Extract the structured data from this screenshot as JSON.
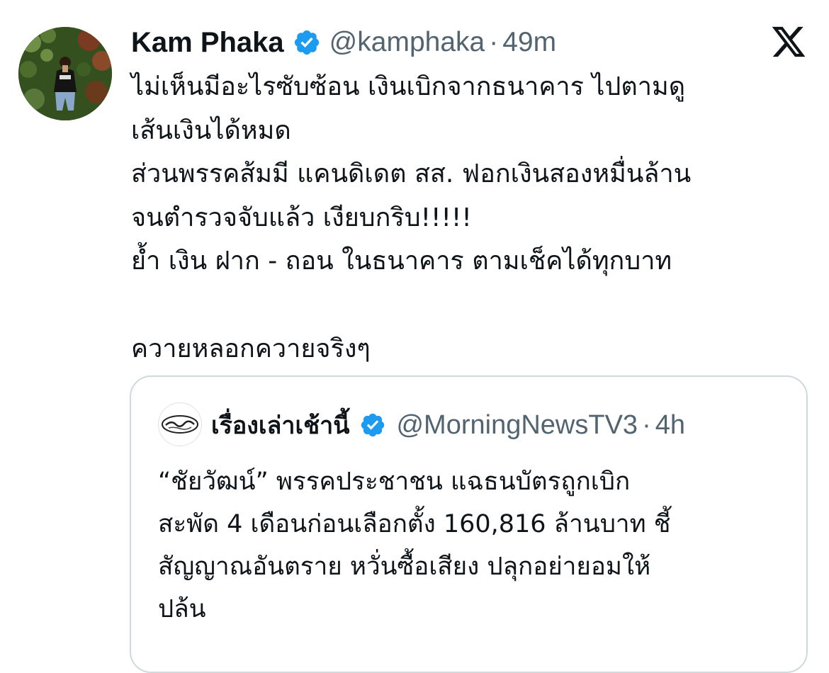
{
  "tweet": {
    "author": {
      "display_name": "Kam Phaka",
      "handle": "@kamphaka",
      "verified_icon": "verified-badge-icon",
      "avatar_icon": "profile-photo"
    },
    "separator": "·",
    "timestamp": "49m",
    "platform_logo": "x-logo-icon",
    "lines": [
      "ไม่เห็นมีอะไรซับซ้อน เงินเบิกจากธนาคาร ไปตามดู",
      "เส้นเงินได้หมด",
      "ส่วนพรรคส้มมี แคนดิเดต สส. ฟอกเงินสองหมื่นล้าน",
      "จนตำรวจจับแล้ว เงียบกริบ!!!!!",
      "ย้ำ เงิน ฝาก - ถอน ในธนาคาร ตามเช็คได้ทุกบาท",
      "",
      "ควายหลอกควายจริงๆ"
    ]
  },
  "quoted_tweet": {
    "author": {
      "display_name": "เรื่องเล่าเช้านี้",
      "handle": "@MorningNewsTV3",
      "verified_icon": "verified-badge-icon",
      "avatar_icon": "morning-news-logo"
    },
    "separator": "·",
    "timestamp": "4h",
    "lines": [
      "“ชัยวัฒน์” พรรคประชาชน แฉธนบัตรถูกเบิก",
      "สะพัด 4 เดือนก่อนเลือกตั้ง 160,816 ล้านบาท ชี้",
      "สัญญาณอันตราย หวั่นซื้อเสียง ปลุกอย่ายอมให้",
      "ปล้น"
    ]
  },
  "colors": {
    "verified_blue": "#1d9bf0",
    "text_primary": "#0f1419",
    "text_secondary": "#536471",
    "quote_border": "#cfd9de"
  }
}
